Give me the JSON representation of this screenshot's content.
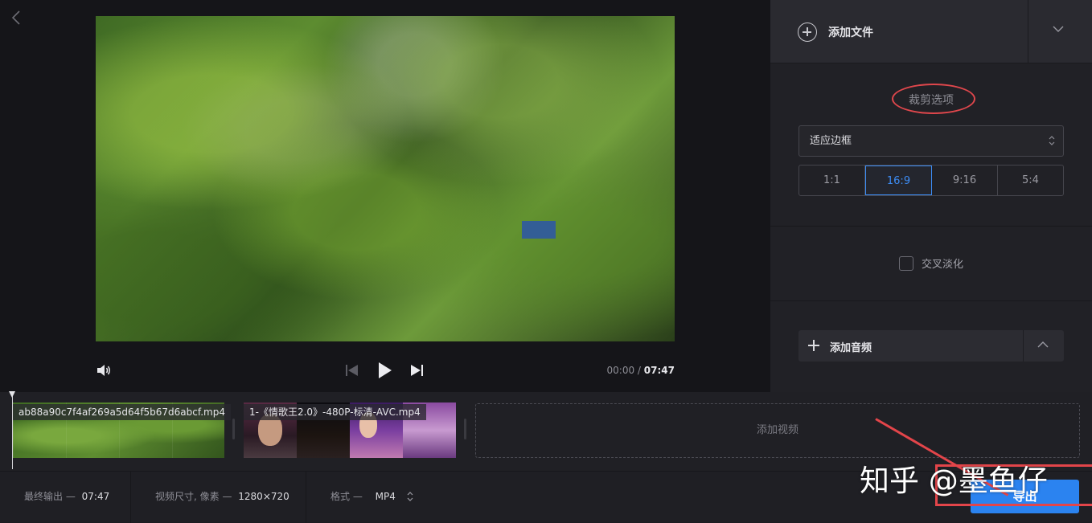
{
  "player": {
    "time_current": "00:00",
    "time_separator": "/",
    "time_total": "07:47"
  },
  "add_file": {
    "label": "添加文件"
  },
  "crop": {
    "title": "裁剪选项",
    "fit_value": "适应边框",
    "ratios": [
      "1:1",
      "16:9",
      "9:16",
      "5:4"
    ],
    "active_ratio": "16:9"
  },
  "crossfade": {
    "label": "交叉淡化",
    "checked": false
  },
  "audio": {
    "label": "添加音频"
  },
  "timeline": {
    "clips": [
      {
        "name": "ab88a90c7f4af269a5d64f5b67d6abcf.mp4"
      },
      {
        "name": "1-《情歌王2.0》-480P-标清-AVC.mp4"
      }
    ],
    "add_video_label": "添加视频"
  },
  "footer": {
    "final_output_label": "最终输出 —",
    "final_output_value": "07:47",
    "video_size_label": "视频尺寸, 像素 —",
    "video_size_value": "1280×720",
    "format_label": "格式 —",
    "format_value": "MP4"
  },
  "export": {
    "label": "导出"
  },
  "watermark": {
    "text": "知乎 @墨鱼仔"
  },
  "colors": {
    "accent": "#2b83f0",
    "annotation": "#e3454a",
    "background": "#1d1d22"
  },
  "icons": [
    "back-icon",
    "volume-icon",
    "skip-previous-icon",
    "play-icon",
    "skip-next-icon",
    "add-circle-icon",
    "chevron-down-icon",
    "sort-arrows-icon",
    "plus-icon",
    "chevron-up-icon"
  ]
}
